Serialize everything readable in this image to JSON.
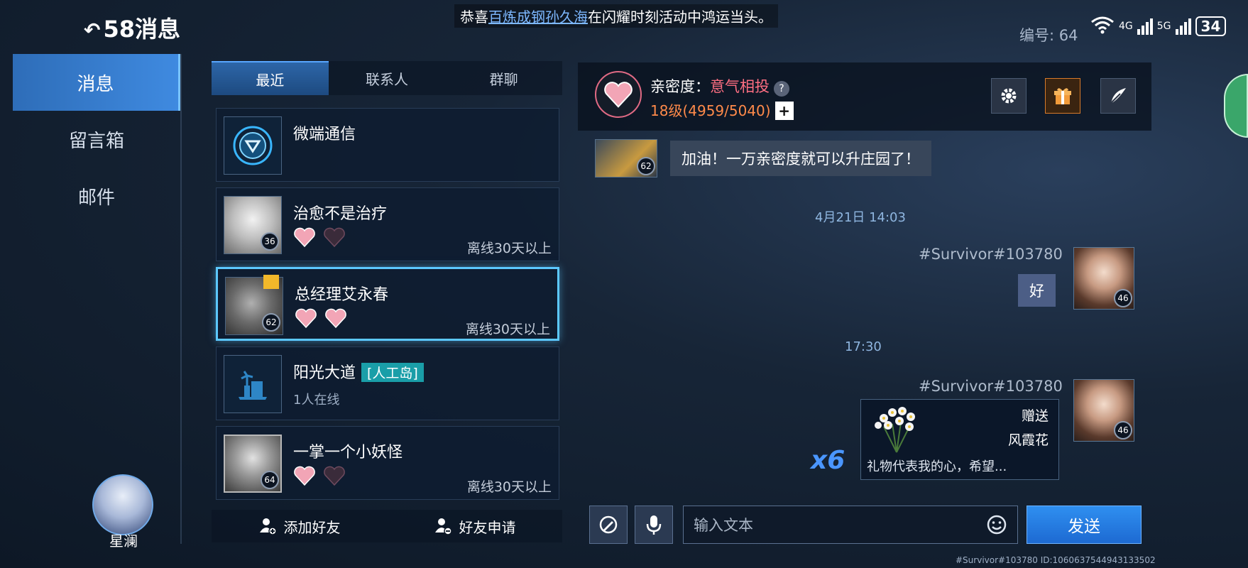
{
  "top": {
    "title": "消息",
    "time_fragment": "58",
    "ticker_prefix": "恭喜",
    "ticker_highlight": "百炼成钢孙久海",
    "ticker_suffix": "在闪耀时刻活动中鸿运当头。",
    "serial": "编号: 64",
    "network": [
      "4G",
      "5G"
    ],
    "battery": "34"
  },
  "nav": {
    "items": [
      {
        "label": "消息"
      },
      {
        "label": "留言箱"
      },
      {
        "label": "邮件"
      }
    ]
  },
  "player": {
    "name": "星澜"
  },
  "tabs": [
    {
      "label": "最近"
    },
    {
      "label": "联系人"
    },
    {
      "label": "群聊"
    }
  ],
  "contacts": [
    {
      "name": "微端通信"
    },
    {
      "name": "治愈不是治疗",
      "level": "36",
      "status": "离线30天以上"
    },
    {
      "name": "总经理艾永春",
      "level": "62",
      "status": "离线30天以上"
    },
    {
      "name": "阳光大道",
      "tag": "[人工岛]",
      "sub": "1人在线"
    },
    {
      "name": "一掌一个小妖怪",
      "level": "64",
      "status": "离线30天以上"
    }
  ],
  "bottom": {
    "add_friend": "添加好友",
    "friend_request": "好友申请"
  },
  "chat": {
    "intimacy_label": "亲密度：",
    "intimacy_value": "意气相投",
    "help": "?",
    "level_text": "18级(4959/5040)",
    "plus": "+",
    "incoming_level": "62",
    "incoming_message": "加油！一万亲密度就可以升庄园了！",
    "time1": "4月21日 14:03",
    "sender1": "#Survivor#103780",
    "reply1": "好",
    "my_level": "46",
    "time2": "17:30",
    "sender2": "#Survivor#103780",
    "gift_label": "赠送",
    "gift_name": "风霞花",
    "gift_note": "礼物代表我的心，希望...",
    "gift_count": "x6"
  },
  "input": {
    "placeholder": "输入文本",
    "send": "发送"
  },
  "footer": {
    "id_text": "#Survivor#103780  ID:1060637544943133502"
  },
  "colors": {
    "accent": "#3f8ae0",
    "intimacy": "#ff6f82",
    "level": "#ff8a4a",
    "gift_count": "#4a96ff"
  }
}
